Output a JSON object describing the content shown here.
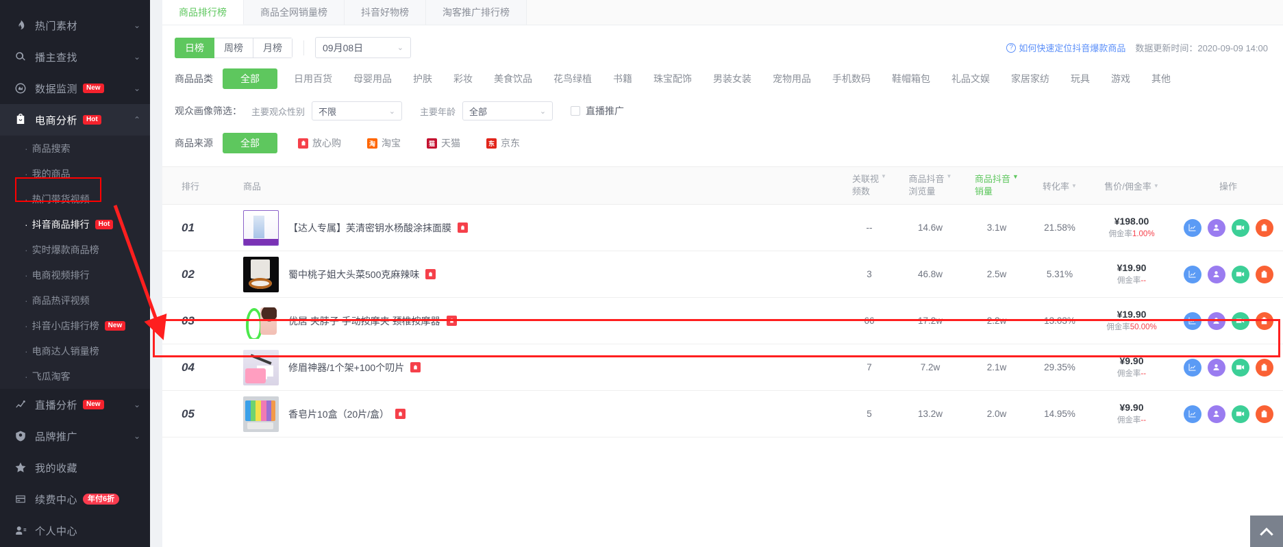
{
  "sidebar": {
    "items": [
      {
        "label": "热门素材",
        "icon": "fire-icon",
        "chevron": "down",
        "badge": null,
        "active": false
      },
      {
        "label": "播主查找",
        "icon": "search-icon",
        "chevron": "down",
        "badge": null,
        "active": false
      },
      {
        "label": "数据监测",
        "icon": "monitor-icon",
        "chevron": "down",
        "badge": "New",
        "active": false
      },
      {
        "label": "电商分析",
        "icon": "shop-bag-icon",
        "chevron": "up",
        "badge": "Hot",
        "active": true
      }
    ],
    "sub_items": [
      {
        "label": "商品搜索",
        "badge": null,
        "selected": false
      },
      {
        "label": "我的商品",
        "badge": null,
        "selected": false
      },
      {
        "label": "热门带货视频",
        "badge": null,
        "selected": false
      },
      {
        "label": "抖音商品排行",
        "badge": "Hot",
        "selected": true
      },
      {
        "label": "实时爆款商品榜",
        "badge": null,
        "selected": false
      },
      {
        "label": "电商视频排行",
        "badge": null,
        "selected": false
      },
      {
        "label": "商品热评视频",
        "badge": null,
        "selected": false
      },
      {
        "label": "抖音小店排行榜",
        "badge": "New",
        "selected": false
      },
      {
        "label": "电商达人销量榜",
        "badge": null,
        "selected": false
      },
      {
        "label": "飞瓜淘客",
        "badge": null,
        "selected": false
      }
    ],
    "bottom_items": [
      {
        "label": "直播分析",
        "icon": "trend-line-icon",
        "chevron": "down",
        "badge": "New"
      },
      {
        "label": "品牌推广",
        "icon": "shield-icon",
        "chevron": "down",
        "badge": null
      },
      {
        "label": "我的收藏",
        "icon": "star-icon",
        "chevron": null,
        "badge": null
      },
      {
        "label": "续费中心",
        "icon": "card-icon",
        "chevron": null,
        "badge": "年付6折"
      },
      {
        "label": "个人中心",
        "icon": "user-icon",
        "chevron": null,
        "badge": null
      }
    ]
  },
  "tabs": [
    {
      "label": "商品排行榜",
      "active": true
    },
    {
      "label": "商品全网销量榜",
      "active": false
    },
    {
      "label": "抖音好物榜",
      "active": false
    },
    {
      "label": "淘客推广排行榜",
      "active": false
    }
  ],
  "toolbar": {
    "period_buttons": [
      {
        "label": "日榜",
        "on": true
      },
      {
        "label": "周榜",
        "on": false
      },
      {
        "label": "月榜",
        "on": false
      }
    ],
    "date_value": "09月08日",
    "help_link": "如何快速定位抖音爆款商品",
    "update_time": "数据更新时间：2020-09-09 14:00"
  },
  "category_filter": {
    "label": "商品品类",
    "options": [
      {
        "label": "全部",
        "on": true
      },
      {
        "label": "日用百货",
        "on": false
      },
      {
        "label": "母婴用品",
        "on": false
      },
      {
        "label": "护肤",
        "on": false
      },
      {
        "label": "彩妆",
        "on": false
      },
      {
        "label": "美食饮品",
        "on": false
      },
      {
        "label": "花鸟绿植",
        "on": false
      },
      {
        "label": "书籍",
        "on": false
      },
      {
        "label": "珠宝配饰",
        "on": false
      },
      {
        "label": "男装女装",
        "on": false
      },
      {
        "label": "宠物用品",
        "on": false
      },
      {
        "label": "手机数码",
        "on": false
      },
      {
        "label": "鞋帽箱包",
        "on": false
      },
      {
        "label": "礼品文娱",
        "on": false
      },
      {
        "label": "家居家纺",
        "on": false
      },
      {
        "label": "玩具",
        "on": false
      },
      {
        "label": "游戏",
        "on": false
      },
      {
        "label": "其他",
        "on": false
      }
    ]
  },
  "audience_filter": {
    "label": "观众画像筛选：",
    "gender_label": "主要观众性别",
    "gender_value": "不限",
    "age_label": "主要年龄",
    "age_value": "全部",
    "live_promo_label": "直播推广",
    "live_promo_checked": false
  },
  "source_filter": {
    "label": "商品来源",
    "options": [
      {
        "label": "全部",
        "on": true,
        "icon": null,
        "icon_color": null
      },
      {
        "label": "放心购",
        "on": false,
        "icon": "fangxingou-icon",
        "icon_color": "#f5404a"
      },
      {
        "label": "淘宝",
        "on": false,
        "icon": "taobao-icon",
        "icon_color": "#ff6600"
      },
      {
        "label": "天猫",
        "on": false,
        "icon": "tmall-icon",
        "icon_color": "#c41230"
      },
      {
        "label": "京东",
        "on": false,
        "icon": "jd-icon",
        "icon_color": "#e1251b"
      }
    ]
  },
  "table": {
    "headers": {
      "rank": "排行",
      "product": "商品",
      "video_count_l1": "关联视",
      "video_count_l2": "频数",
      "views_l1": "商品抖音",
      "views_l2": "浏览量",
      "sales_l1": "商品抖音",
      "sales_l2": "销量",
      "conversion": "转化率",
      "price": "售价/佣金率",
      "operation": "操作"
    },
    "sorted_column": "sales",
    "sorted_color": "#5ec75e",
    "rows": [
      {
        "rank": "01",
        "name": "【达人专属】芙清密钥水杨酸涂抹面膜",
        "shop_tag": "fangxingou-icon",
        "video_count": "--",
        "views": "14.6w",
        "sales": "3.1w",
        "conversion": "21.58%",
        "price": "¥198.00",
        "commission_label": "佣金率",
        "commission_value": "1.00%",
        "highlighted": false
      },
      {
        "rank": "02",
        "name": "蜀中桃子姐大头菜500克麻辣味",
        "shop_tag": "fangxingou-icon",
        "video_count": "3",
        "views": "46.8w",
        "sales": "2.5w",
        "conversion": "5.31%",
        "price": "¥19.90",
        "commission_label": "佣金率",
        "commission_value": "--",
        "highlighted": false
      },
      {
        "rank": "03",
        "name": "优居 夹脖子 手动按摩夹 颈椎按摩器",
        "shop_tag": "fangxingou-icon",
        "video_count": "66",
        "views": "17.2w",
        "sales": "2.2w",
        "conversion": "13.03%",
        "price": "¥19.90",
        "commission_label": "佣金率",
        "commission_value": "50.00%",
        "highlighted": true
      },
      {
        "rank": "04",
        "name": "修眉神器/1个架+100个叨片",
        "shop_tag": "fangxingou-icon",
        "video_count": "7",
        "views": "7.2w",
        "sales": "2.1w",
        "conversion": "29.35%",
        "price": "¥9.90",
        "commission_label": "佣金率",
        "commission_value": "--",
        "highlighted": false
      },
      {
        "rank": "05",
        "name": "香皂片10盒（20片/盒）",
        "shop_tag": "fangxingou-icon",
        "video_count": "5",
        "views": "13.2w",
        "sales": "2.0w",
        "conversion": "14.95%",
        "price": "¥9.90",
        "commission_label": "佣金率",
        "commission_value": "--",
        "highlighted": false
      }
    ],
    "action_icons": [
      {
        "name": "trend-chart-icon",
        "color": "#5b9bf5"
      },
      {
        "name": "person-icon",
        "color": "#9a7cf0"
      },
      {
        "name": "video-icon",
        "color": "#3ccf97"
      },
      {
        "name": "shop-icon",
        "color": "#fa6134"
      }
    ]
  },
  "colors": {
    "accent_green": "#5ec75e",
    "annotation_red": "#ff1f1f",
    "link_blue": "#5b8ff9",
    "sidebar_bg": "#1e2029"
  },
  "back_to_top": "scroll-to-top"
}
